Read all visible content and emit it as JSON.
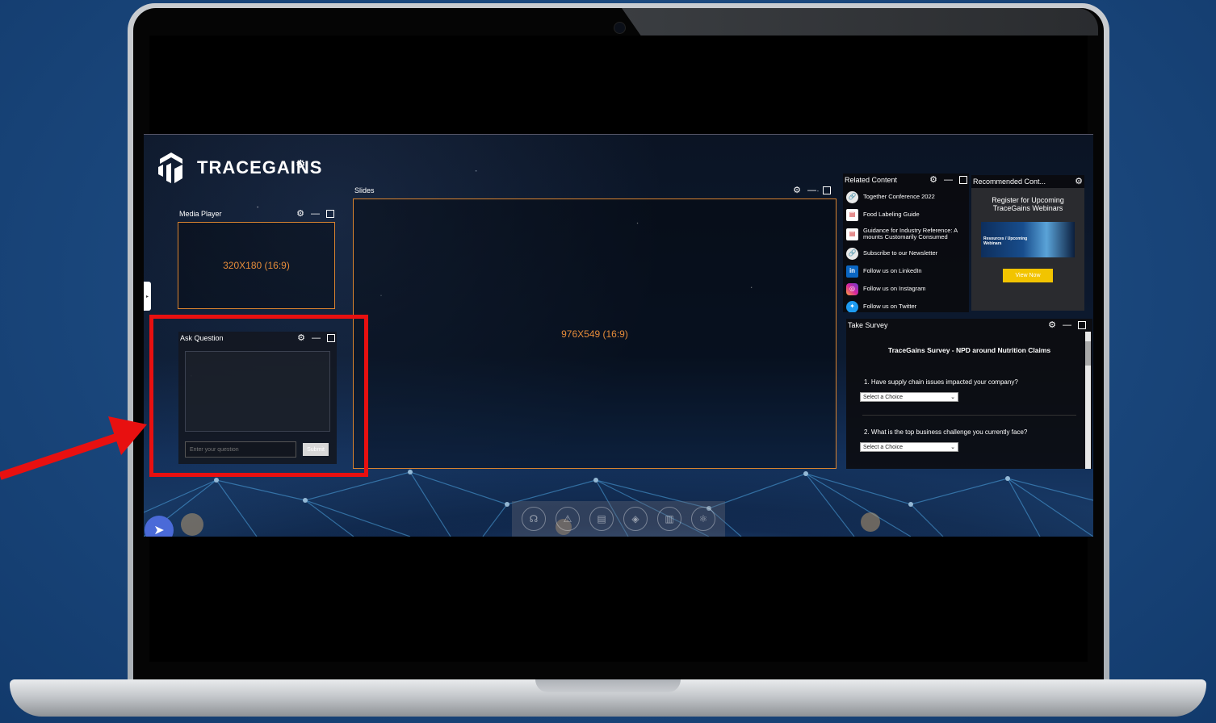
{
  "brand": {
    "name": "TRACEGAINS"
  },
  "media_player": {
    "title": "Media Player",
    "placeholder": "320X180 (16:9)"
  },
  "slides": {
    "title": "Slides",
    "placeholder": "976X549 (16:9)"
  },
  "ask_question": {
    "title": "Ask Question",
    "input_placeholder": "Enter your question",
    "submit_label": "Submit"
  },
  "related_content": {
    "title": "Related Content",
    "items": [
      {
        "label": "Together Conference 2022",
        "icon": "link-icon"
      },
      {
        "label": "Food Labeling Guide",
        "icon": "pdf-icon"
      },
      {
        "label": "Guidance for Industry Reference: A mounts Customarily Consumed",
        "icon": "pdf-icon"
      },
      {
        "label": "Subscribe to our Newsletter",
        "icon": "link-icon"
      },
      {
        "label": "Follow us on LinkedIn",
        "icon": "linkedin-icon"
      },
      {
        "label": "Follow us on Instagram",
        "icon": "instagram-icon"
      },
      {
        "label": "Follow us on Twitter",
        "icon": "twitter-icon"
      }
    ]
  },
  "recommended": {
    "title": "Recommended Cont...",
    "card_title": "Register for Upcoming TraceGains Webinars",
    "image_caption": "Resources / Upcoming Webinars",
    "button_label": "View Now"
  },
  "survey": {
    "title": "Take Survey",
    "heading": "TraceGains Survey - NPD around Nutrition Claims",
    "questions": [
      {
        "text": "1. Have supply chain issues impacted your company?",
        "select": "Select a Choice"
      },
      {
        "text": "2. What is the top business challenge you currently face?",
        "select": "Select a Choice"
      }
    ]
  },
  "colors": {
    "accent": "#d9832f",
    "highlight": "#e81010",
    "button_yellow": "#f2c400"
  }
}
